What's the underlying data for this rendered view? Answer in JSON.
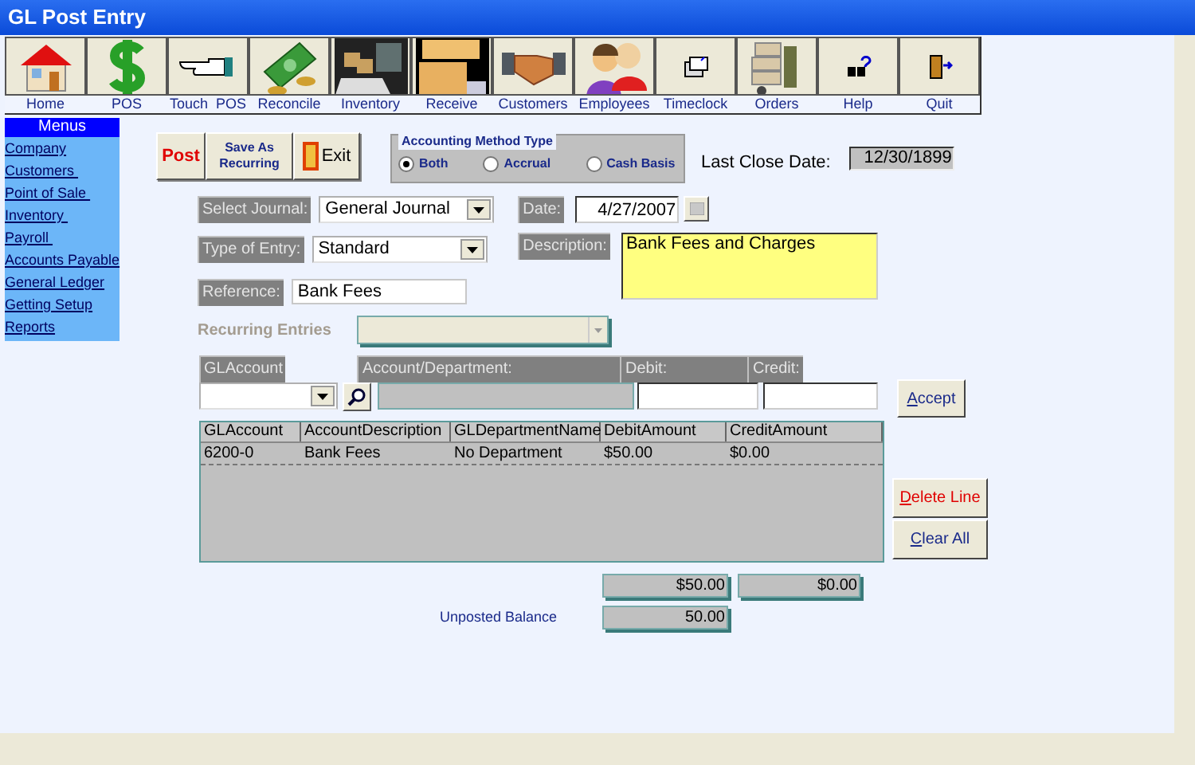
{
  "window": {
    "title": "GL Post Entry"
  },
  "toolbar": [
    {
      "label": "Home"
    },
    {
      "label": "POS"
    },
    {
      "label": "Touch  POS"
    },
    {
      "label": "Reconcile"
    },
    {
      "label": "Inventory"
    },
    {
      "label": "Receive"
    },
    {
      "label": "Customers"
    },
    {
      "label": "Employees"
    },
    {
      "label": "Timeclock"
    },
    {
      "label": "Orders"
    },
    {
      "label": "Help"
    },
    {
      "label": "Quit"
    }
  ],
  "sidebar": {
    "title": "Menus",
    "items": [
      "Company",
      "Customers ",
      "Point of Sale ",
      "Inventory ",
      "Payroll ",
      "Accounts Payable",
      "General Ledger",
      "Getting Setup",
      "Reports"
    ]
  },
  "actions": [
    {
      "kind": "post",
      "label": "Post"
    },
    {
      "kind": "recurring",
      "label": "Save As Recurring"
    },
    {
      "kind": "exit",
      "label": "Exit"
    }
  ],
  "accounting_method": {
    "title": "Accounting Method Type",
    "options": [
      {
        "label": "Both",
        "selected": true
      },
      {
        "label": "Accrual",
        "selected": false
      },
      {
        "label": "Cash Basis",
        "selected": false
      }
    ]
  },
  "last_close_date": {
    "label": "Last Close Date:",
    "value": "12/30/1899"
  },
  "select_journal": {
    "label": "Select Journal:",
    "value": "General Journal"
  },
  "type_of_entry": {
    "label": "Type of Entry:",
    "value": "Standard"
  },
  "reference": {
    "label": "Reference:",
    "value": "Bank Fees"
  },
  "date": {
    "label": "Date:",
    "value": "4/27/2007"
  },
  "description": {
    "label": "Description:",
    "value": "Bank Fees and Charges"
  },
  "recurring_entries": {
    "label": "Recurring Entries",
    "disabled": true
  },
  "entry_line": {
    "gl_account": "GLAccount",
    "account_department": "Account/Department:",
    "debit": "Debit:",
    "credit": "Credit:"
  },
  "accept_button": {
    "label": "Accept",
    "mnemonic": true
  },
  "table": {
    "columns": [
      "GLAccount",
      "AccountDescription",
      "GLDepartmentName",
      "DebitAmount",
      "CreditAmount"
    ],
    "rows": [
      [
        "6200-0",
        "Bank Fees",
        "No Department",
        "$50.00",
        "$0.00"
      ]
    ]
  },
  "delete_line_button": {
    "label": "Delete Line",
    "mnemonic": true
  },
  "clear_all_button": {
    "label": "Clear All",
    "mnemonic": true
  },
  "totals": {
    "debit": "$50.00",
    "credit": "$0.00"
  },
  "unposted_balance": {
    "label": "Unposted Balance",
    "value": "50.00"
  }
}
